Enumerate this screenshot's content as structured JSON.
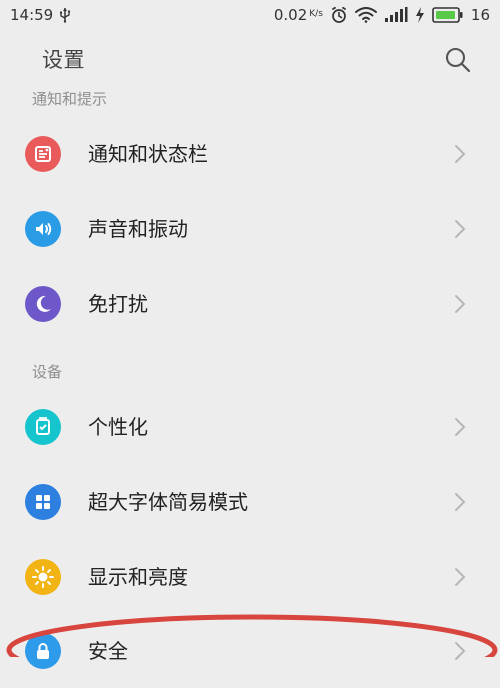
{
  "status_bar": {
    "time": "14:59",
    "speed_value": "0.02",
    "speed_unit": "K/s",
    "battery_level": "16",
    "icons": [
      "usb-icon",
      "alarm-icon",
      "wifi-icon",
      "signal-icon",
      "charging-icon",
      "battery-icon"
    ]
  },
  "header": {
    "title": "设置",
    "search_icon": "search-icon"
  },
  "sections": [
    {
      "label": "通知和提示",
      "items": [
        {
          "label": "通知和状态栏",
          "icon": "notification-icon",
          "color": "#e95b5b"
        },
        {
          "label": "声音和振动",
          "icon": "sound-icon",
          "color": "#2a9ce6"
        },
        {
          "label": "免打扰",
          "icon": "moon-icon",
          "color": "#6e57c9"
        }
      ]
    },
    {
      "label": "设备",
      "items": [
        {
          "label": "个性化",
          "icon": "personalize-icon",
          "color": "#16c4cd"
        },
        {
          "label": "超大字体简易模式",
          "icon": "grid-icon",
          "color": "#2d7fe0"
        },
        {
          "label": "显示和亮度",
          "icon": "sun-icon",
          "color": "#f2b314"
        },
        {
          "label": "安全",
          "icon": "lock-icon",
          "color": "#2d9bea"
        }
      ]
    }
  ],
  "colors": {
    "background": "#ededed",
    "annotation": "#d8453e",
    "chevron": "#b7b7b7"
  }
}
